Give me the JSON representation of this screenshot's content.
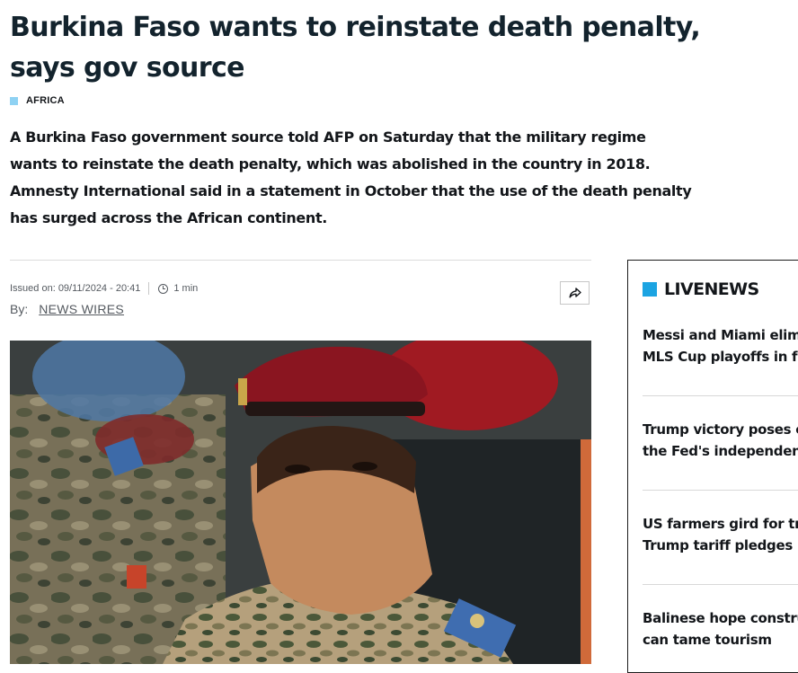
{
  "article": {
    "headline_line1": "Burkina Faso wants to reinstate death penalty,",
    "headline_line2": "says gov source",
    "category": "AFRICA",
    "lead_lines": [
      "A Burkina Faso government source told AFP on Saturday that the military regime",
      "wants to reinstate the death penalty, which was abolished in the country in 2018.",
      "Amnesty International said in a statement in October that the use of the death penalty",
      "has surged across the African continent."
    ],
    "issued": "Issued on: 09/11/2024 - 20:41",
    "read_time": "1 min",
    "by_label": "By:",
    "author": "NEWS WIRES"
  },
  "livenews": {
    "title": "LIVENEWS",
    "items": [
      {
        "line1": "Messi and Miami elimi",
        "line2": "MLS Cup playoffs in fir"
      },
      {
        "line1": "Trump victory poses c",
        "line2": "the Fed's independenc"
      },
      {
        "line1": "US farmers gird for tra",
        "line2": "Trump tariff pledges"
      },
      {
        "line1": "Balinese hope constru",
        "line2": "can tame tourism"
      }
    ]
  },
  "colors": {
    "category_square": "#8fd2f3",
    "livenews_square": "#1ca4e2",
    "headline": "#13232d"
  },
  "icons": [
    "clock-icon",
    "share-icon"
  ]
}
